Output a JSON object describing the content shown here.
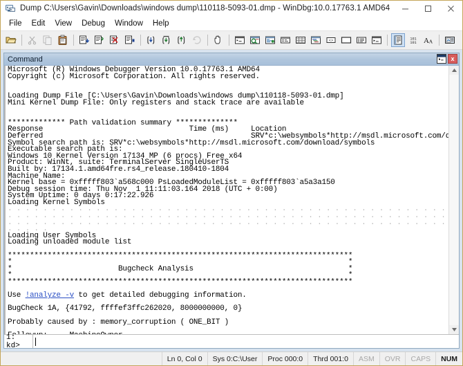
{
  "window": {
    "title": "Dump C:\\Users\\Gavin\\Downloads\\windows dump\\110118-5093-01.dmp - WinDbg:10.0.17763.1 AMD64",
    "icon": "windbg-app-icon",
    "minimize_label": "–",
    "maximize_label": "□",
    "close_label": "✕"
  },
  "menubar": {
    "items": [
      {
        "label": "File"
      },
      {
        "label": "Edit"
      },
      {
        "label": "View"
      },
      {
        "label": "Debug"
      },
      {
        "label": "Window"
      },
      {
        "label": "Help"
      }
    ]
  },
  "toolbar": {
    "buttons": [
      {
        "name": "open-dump-icon",
        "kind": "folder",
        "disabled": false
      },
      {
        "kind": "sep"
      },
      {
        "name": "cut-icon",
        "kind": "scissors",
        "disabled": true
      },
      {
        "name": "copy-icon",
        "kind": "copy",
        "disabled": true
      },
      {
        "name": "paste-icon",
        "kind": "paste",
        "disabled": false
      },
      {
        "kind": "sep"
      },
      {
        "name": "step-into-source-icon",
        "kind": "box-arrow-down",
        "disabled": false
      },
      {
        "name": "step-over-source-icon",
        "kind": "box-arrow-right",
        "disabled": false
      },
      {
        "name": "stop-debugging-icon",
        "kind": "box-x",
        "disabled": false
      },
      {
        "name": "run-to-cursor-icon",
        "kind": "box-bar",
        "disabled": false
      },
      {
        "kind": "sep"
      },
      {
        "name": "step-into-icon",
        "kind": "brace-down",
        "disabled": false
      },
      {
        "name": "step-over-icon",
        "kind": "brace-over",
        "disabled": false
      },
      {
        "name": "step-out-icon",
        "kind": "brace-out",
        "disabled": false
      },
      {
        "name": "restart-icon",
        "kind": "restart",
        "disabled": true
      },
      {
        "kind": "sep"
      },
      {
        "name": "break-icon",
        "kind": "hand",
        "disabled": false
      },
      {
        "kind": "sep"
      },
      {
        "name": "command-window-icon",
        "kind": "win-cmd",
        "disabled": false
      },
      {
        "name": "watch-window-icon",
        "kind": "win-watch",
        "disabled": false
      },
      {
        "name": "locals-window-icon",
        "kind": "win-locals",
        "disabled": false
      },
      {
        "name": "registers-window-icon",
        "kind": "win-registers",
        "disabled": false
      },
      {
        "name": "memory-window-icon",
        "kind": "win-memory",
        "disabled": false
      },
      {
        "name": "call-stack-window-icon",
        "kind": "win-callstack",
        "disabled": false
      },
      {
        "name": "disassembly-window-icon",
        "kind": "win-disasm",
        "disabled": false
      },
      {
        "name": "scratch-pad-icon",
        "kind": "win-blank",
        "disabled": false
      },
      {
        "name": "processes-threads-icon",
        "kind": "win-list",
        "disabled": false
      },
      {
        "name": "command-browser-icon",
        "kind": "win-browser",
        "disabled": false
      },
      {
        "kind": "sep"
      },
      {
        "name": "source-mode-icon",
        "kind": "source-mode",
        "disabled": false,
        "active": true
      },
      {
        "name": "numeric-base-icon",
        "kind": "numeric",
        "disabled": false
      },
      {
        "name": "font-icon",
        "kind": "font-aa",
        "disabled": false
      },
      {
        "kind": "sep"
      },
      {
        "name": "options-icon",
        "kind": "options",
        "disabled": false
      }
    ]
  },
  "command_window": {
    "title": "Command",
    "restore_label": "",
    "close_label": "x",
    "prompt": "1: kd>",
    "input_value": "",
    "scroll_up_glyph": "▲",
    "scroll_down_glyph": "▼",
    "console_lines": [
      "Microsoft (R) Windows Debugger Version 10.0.17763.1 AMD64",
      "Copyright (c) Microsoft Corporation. All rights reserved.",
      "",
      "",
      "Loading Dump File [C:\\Users\\Gavin\\Downloads\\windows dump\\110118-5093-01.dmp]",
      "Mini Kernel Dump File: Only registers and stack trace are available",
      "",
      "",
      "************* Path validation summary **************",
      "Response                                 Time (ms)     Location",
      "Deferred                                               SRV*c:\\websymbols*http://msdl.microsoft.com/download/symbols",
      "Symbol search path is: SRV*c:\\websymbols*http://msdl.microsoft.com/download/symbols",
      "Executable search path is: ",
      "Windows 10 Kernel Version 17134 MP (6 procs) Free x64",
      "Product: WinNt, suite: TerminalServer SingleUserTS",
      "Built by: 17134.1.amd64fre.rs4_release.180410-1804",
      "Machine Name:",
      "Kernel base = 0xfffff803`a568c000 PsLoadedModuleList = 0xfffff803`a5a3a150",
      "Debug session time: Thu Nov  1 11:11:03.164 2018 (UTC + 0:00)",
      "System Uptime: 0 days 0:17:22.926",
      "Loading Kernel Symbols",
      "DOTS72",
      "DOTS72",
      "DOTS72",
      "DOTS5",
      "Loading User Symbols",
      "Loading unloaded module list",
      "",
      "STARS78",
      "*                                                                            *",
      "*                        Bugcheck Analysis                                   *",
      "*                                                                            *",
      "STARS78",
      "",
      "Use LINK_ANALYZE to get detailed debugging information.",
      "",
      "BugCheck 1A, {41792, ffffef3ffc262020, 8000000000, 0}",
      "",
      "Probably caused by : memory_corruption ( ONE_BIT )",
      "",
      "Followup:     MachineOwner",
      "---------"
    ],
    "analyze_link_text": "!analyze -v"
  },
  "statusbar": {
    "cells": [
      {
        "label": "Ln 0, Col 0",
        "state": "normal"
      },
      {
        "label": "Sys 0:C:\\User",
        "state": "normal"
      },
      {
        "label": "Proc 000:0",
        "state": "normal"
      },
      {
        "label": "Thrd 001:0",
        "state": "normal"
      },
      {
        "label": "ASM",
        "state": "dim"
      },
      {
        "label": "OVR",
        "state": "dim"
      },
      {
        "label": "CAPS",
        "state": "dim"
      },
      {
        "label": "NUM",
        "state": "bold"
      }
    ]
  },
  "colors": {
    "window_border": "#c4a55a",
    "mdi_background": "#d8e3ef",
    "cmd_titlebar": "#b0c6dd",
    "link": "#2a4fc4",
    "toolbar_active": "#cde0f5",
    "close_red": "#d85c5c"
  }
}
